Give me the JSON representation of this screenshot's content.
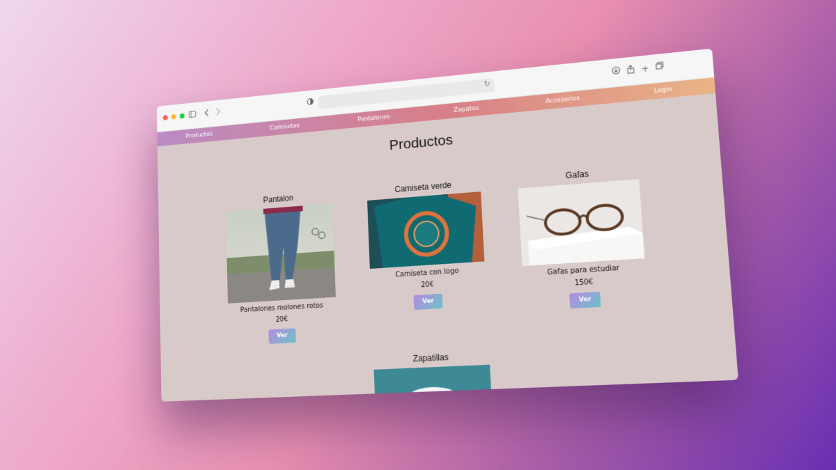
{
  "browser": {
    "traffic_colors": [
      "#ff5f57",
      "#febc2e",
      "#28c840"
    ],
    "icons": [
      "sidebar-icon",
      "back-arrow-icon",
      "forward-arrow-icon",
      "shield-icon",
      "reload-icon",
      "download-icon",
      "share-icon",
      "new-tab-icon",
      "tabs-overview-icon"
    ]
  },
  "navbar": {
    "items": [
      "Productos",
      "Camisetas",
      "Pantalones",
      "Zapatos",
      "Accesorios",
      "Login"
    ],
    "gradient": [
      "#bb8bc4",
      "#d87f88",
      "#e8b486"
    ]
  },
  "page": {
    "title": "Productos",
    "background": "#d9caca"
  },
  "products": [
    {
      "name": "Pantalon",
      "description": "Pantalones molones rotos",
      "price": "20€",
      "button": "Ver"
    },
    {
      "name": "Camiseta verde",
      "description": "Camiseta con logo",
      "price": "20€",
      "button": "Ver"
    },
    {
      "name": "Gafas",
      "description": "Gafas para estudiar",
      "price": "150€",
      "button": "Ver"
    },
    {
      "name": "Zapatillas"
    }
  ]
}
